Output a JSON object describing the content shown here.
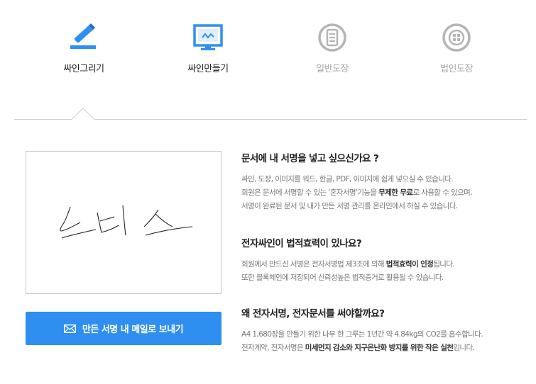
{
  "tabs": [
    {
      "label": "싸인그리기",
      "icon": "pen-sign-icon",
      "active": true
    },
    {
      "label": "싸인만들기",
      "icon": "monitor-sign-icon",
      "active": true
    },
    {
      "label": "일반도장",
      "icon": "round-stamp-icon",
      "active": false
    },
    {
      "label": "법인도장",
      "icon": "corporate-stamp-icon",
      "active": false
    }
  ],
  "colors": {
    "accent": "#2f8ff0",
    "inactive": "#b5b5b5"
  },
  "signature": {
    "text": "노비스"
  },
  "send_button": {
    "label": "만든 서명 내 메일로 보내기",
    "icon": "mail-icon"
  },
  "info": [
    {
      "title": "문서에 내 서명을 넣고 싶으신가요 ?",
      "lines": [
        {
          "text": "싸인, 도장, 이미지를 워드, 한글, PDF, 이미지에 쉽게 넣으실 수 있습니다."
        },
        {
          "pre": "회원은 문서에 서명할 수 있는 '혼자서명'기능을 ",
          "bold": "무제한 무료",
          "post": "로 사용할 수 있으며,"
        },
        {
          "text": "서명이 완료된 문서 및 내가 만든 서명 관리를 온라인에서 하실 수 있습니다."
        }
      ]
    },
    {
      "title": "전자싸인이 법적효력이 있나요?",
      "lines": [
        {
          "pre": "회원께서 만드신 서명은 전자서명법 제3조에 의해 ",
          "bold": "법적효력이 인정",
          "post": "됩니다."
        },
        {
          "text": "또한 블록체인에 저장되어 신뢰성높은 법적증거로 활용될 수 있습니다."
        }
      ]
    },
    {
      "title": "왜 전자서명, 전자문서를 써야할까요?",
      "lines": [
        {
          "text": "A4 1,680장을 만들기 위한 나무 한 그루는 1년간 약 4.84kg의 CO2를 흡수합니다."
        },
        {
          "pre": "전자계약, 전자서명은 ",
          "bold": "미세먼지 감소와 지구온난화 방지를 위한 작은 실천",
          "post": "입니다."
        }
      ]
    }
  ]
}
